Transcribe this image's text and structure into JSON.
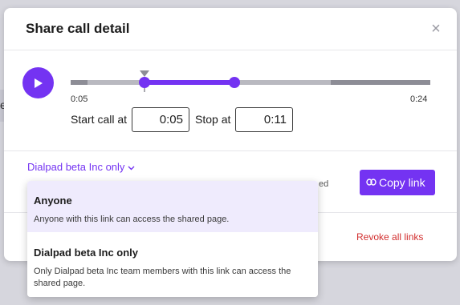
{
  "background": {
    "edge_char": "e"
  },
  "modal": {
    "title": "Share call detail",
    "close_icon": "close-icon"
  },
  "player": {
    "play_icon": "play-icon",
    "range_start_label": "0:05",
    "range_end_label": "0:24",
    "selection_start_fraction": 0.206,
    "selection_end_fraction": 0.455,
    "playhead_fraction": 0.206,
    "accent_color": "#7433f2"
  },
  "fields": {
    "start_label": "Start call at",
    "start_value": "0:05",
    "stop_label": "Stop at",
    "stop_value": "0:11"
  },
  "share": {
    "scope_selected": "Dialpad beta Inc only",
    "obscured_text": "ed",
    "copy_label": "Copy link",
    "copy_icon": "link-icon",
    "revoke_label": "Revoke all links",
    "revoke_color": "#d22e2e"
  },
  "dropdown": {
    "options": [
      {
        "title": "Anyone",
        "description": "Anyone with this link can access the shared page.",
        "highlighted": true
      },
      {
        "title": "Dialpad beta Inc only",
        "description": "Only Dialpad beta Inc team members with this link can access the shared page.",
        "highlighted": false
      }
    ]
  }
}
